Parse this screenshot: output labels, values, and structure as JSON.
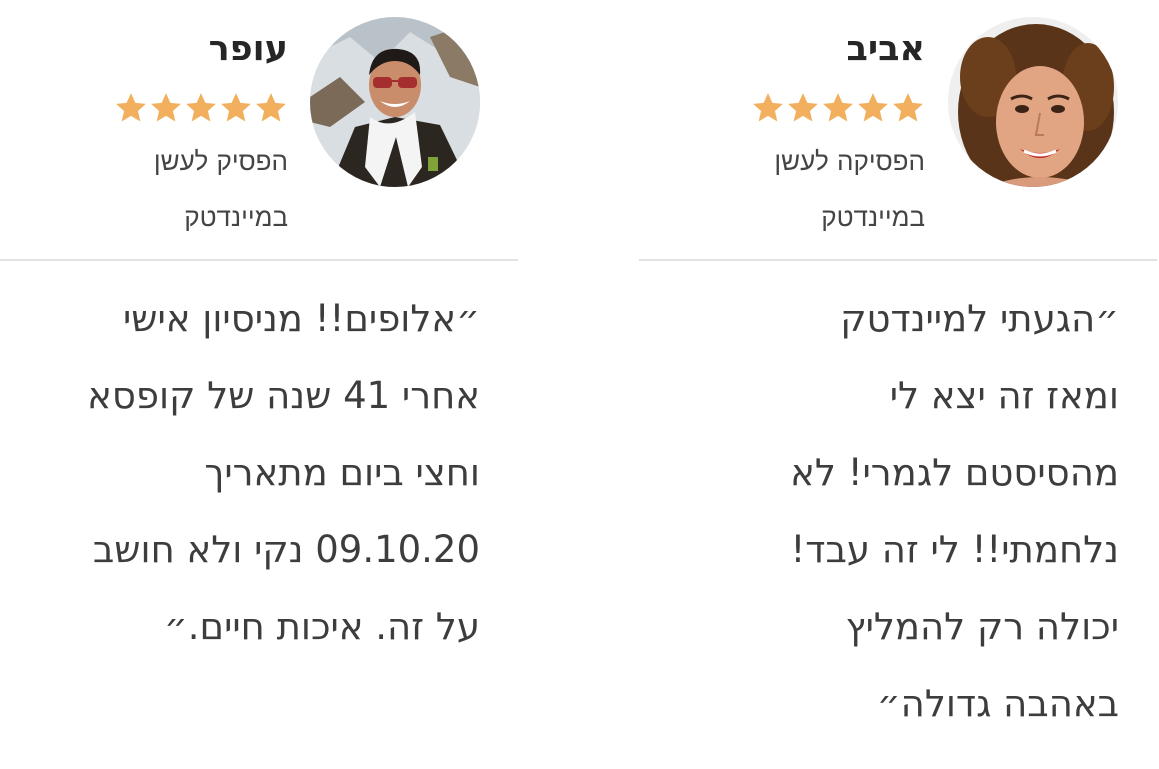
{
  "testimonials": [
    {
      "name": "אביב",
      "rating": 5,
      "subtitle_line1": "הפסיקה לעשן",
      "subtitle_line2": "במיינדטק",
      "quote_lines": [
        "״הגעתי למיינדטק",
        "ומאז זה יצא לי",
        "מהסיסטם לגמרי! לא",
        "נלחמתי!! לי זה עבד!",
        "יכולה רק להמליץ",
        "באהבה גדולה״"
      ],
      "avatar_icon": "woman-portrait-icon"
    },
    {
      "name": "עופר",
      "rating": 5,
      "subtitle_line1": "הפסיק לעשן",
      "subtitle_line2": "במיינדטק",
      "quote_lines": [
        "״אלופים!! מניסיון אישי",
        "אחרי 41 שנה של קופסא",
        "וחצי ביום מתאריך",
        "09.10.20 נקי ולא חושב",
        "על זה. איכות חיים.״"
      ],
      "avatar_icon": "man-portrait-icon"
    }
  ],
  "colors": {
    "star": "#F2B05E",
    "divider": "#E2E2E2",
    "name": "#262626",
    "text": "#3D3D3D"
  }
}
